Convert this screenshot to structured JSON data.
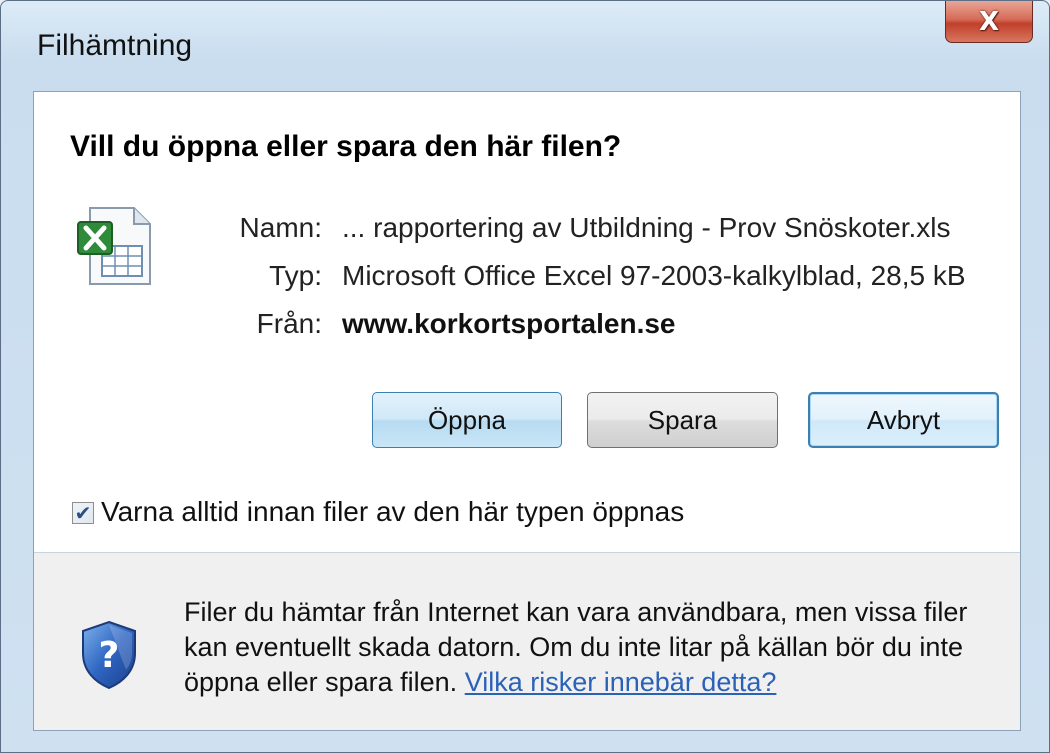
{
  "window": {
    "title": "Filhämtning",
    "close_label": "X"
  },
  "dialog": {
    "heading": "Vill du öppna eller spara den här filen?",
    "file_icon": "excel-file-icon",
    "fields": {
      "name_label": "Namn:",
      "name_value": "... rapportering av Utbildning - Prov Snöskoter.xls",
      "type_label": "Typ:",
      "type_value": "Microsoft Office Excel 97-2003-kalkylblad, 28,5 kB",
      "from_label": "Från:",
      "from_value": "www.korkortsportalen.se"
    },
    "buttons": {
      "open": "Öppna",
      "save": "Spara",
      "cancel": "Avbryt"
    },
    "checkbox": {
      "checked": true,
      "label": "Varna alltid innan filer av den här typen öppnas"
    },
    "warning": {
      "icon": "shield-question-icon",
      "text": "Filer du hämtar från Internet kan vara användbara, men vissa filer kan eventuellt skada datorn. Om du inte litar på källan bör du inte öppna eller spara filen.",
      "link": "Vilka risker innebär detta?"
    }
  },
  "colors": {
    "link": "#2a62b8",
    "default_button_border": "#3c7fb1",
    "close_button": "#c0402b"
  }
}
